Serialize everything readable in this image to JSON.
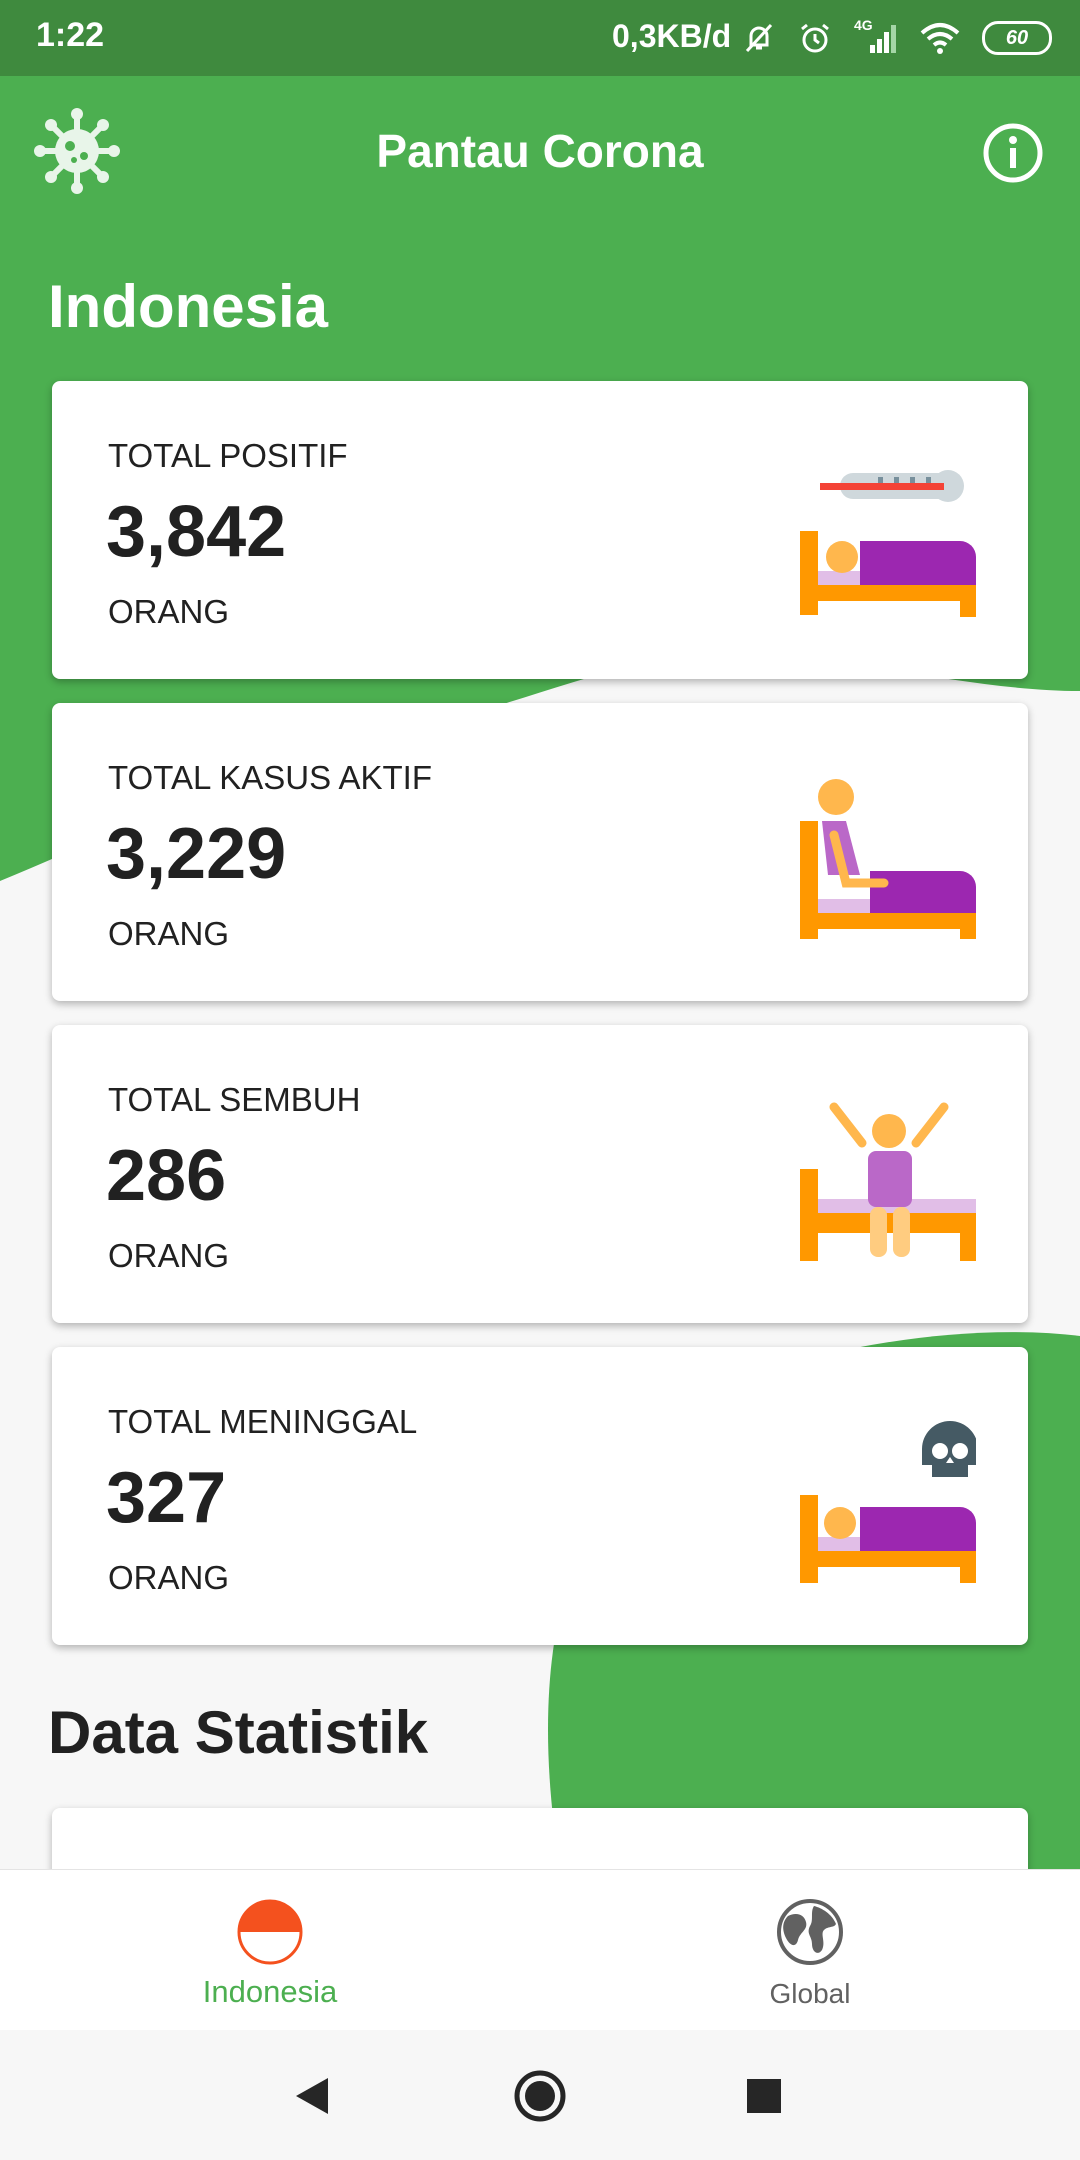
{
  "status_bar": {
    "time": "1:22",
    "network_speed": "0,3KB/d",
    "network_type": "4G",
    "battery": "60",
    "icons": [
      "notifications-off-icon",
      "alarm-icon",
      "signal-icon",
      "wifi-icon",
      "battery-icon"
    ]
  },
  "app_bar": {
    "title": "Pantau Corona",
    "logo_icon": "virus-icon",
    "info_icon": "info-icon"
  },
  "colors": {
    "primary": "#4caf50",
    "status_bar": "#3f8a3e",
    "flag_red": "#f4511e",
    "text": "#212121"
  },
  "main": {
    "country_title": "Indonesia",
    "stat_title": "Data Statistik",
    "cards": [
      {
        "label": "TOTAL POSITIF",
        "value": "3,842",
        "unit": "ORANG",
        "icon": "sick-in-bed-thermometer-icon"
      },
      {
        "label": "TOTAL KASUS AKTIF",
        "value": "3,229",
        "unit": "ORANG",
        "icon": "patient-in-bed-icon"
      },
      {
        "label": "TOTAL SEMBUH",
        "value": "286",
        "unit": "ORANG",
        "icon": "recovered-patient-icon"
      },
      {
        "label": "TOTAL MENINGGAL",
        "value": "327",
        "unit": "ORANG",
        "icon": "deceased-patient-skull-icon"
      }
    ]
  },
  "bottom_nav": {
    "items": [
      {
        "label": "Indonesia",
        "icon": "indonesia-flag-icon",
        "active": true
      },
      {
        "label": "Global",
        "icon": "globe-icon",
        "active": false
      }
    ]
  },
  "system_nav": {
    "buttons": [
      "back-button",
      "home-button",
      "recents-button"
    ]
  }
}
